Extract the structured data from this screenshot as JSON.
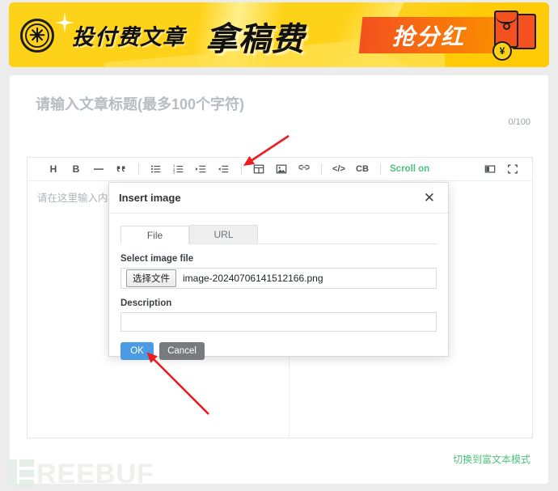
{
  "banner": {
    "coin_icon": "coin-asterisk-icon",
    "sparkle_icon": "sparkle-icon",
    "text_1": "投付费文章",
    "text_2": "拿稿费",
    "badge_text": "抢分红",
    "envelope_icon": "red-envelope-icon",
    "coin_symbol": "¥",
    "colors": {
      "background": "#ffd21a",
      "badge_from": "#f4511e",
      "badge_to": "#fb8c00"
    }
  },
  "article": {
    "title_placeholder": "请输入文章标题(最多100个字符)",
    "title_value": "",
    "counter": "0/100"
  },
  "toolbar": {
    "groups": [
      [
        {
          "name": "heading-icon",
          "glyph": "H"
        },
        {
          "name": "bold-icon",
          "glyph": "B"
        },
        {
          "name": "horizontal-rule-icon",
          "glyph": "—"
        },
        {
          "name": "quote-icon",
          "glyph": "“"
        }
      ],
      [
        {
          "name": "bullet-list-icon",
          "glyph": ""
        },
        {
          "name": "ordered-list-icon",
          "glyph": ""
        },
        {
          "name": "indent-icon",
          "glyph": ""
        },
        {
          "name": "outdent-icon",
          "glyph": ""
        }
      ],
      [
        {
          "name": "table-icon",
          "glyph": ""
        },
        {
          "name": "image-icon",
          "glyph": ""
        },
        {
          "name": "link-icon",
          "glyph": ""
        }
      ],
      [
        {
          "name": "inline-code-icon",
          "glyph": "</>"
        },
        {
          "name": "code-block-icon",
          "glyph": "CB"
        }
      ]
    ],
    "scroll_label": "Scroll on",
    "scroll_color": "#4cc27e",
    "right_icons": [
      {
        "name": "split-view-icon"
      },
      {
        "name": "fullscreen-icon"
      }
    ]
  },
  "editor": {
    "content_placeholder": "请在这里输入内容"
  },
  "modal": {
    "title": "Insert image",
    "close_icon": "close-icon",
    "tabs": [
      {
        "label": "File",
        "active": true
      },
      {
        "label": "URL",
        "active": false
      }
    ],
    "file_field": {
      "label": "Select image file",
      "button_label": "选择文件",
      "file_name": "image-20240706141512166.png"
    },
    "description_field": {
      "label": "Description",
      "value": "",
      "placeholder": ""
    },
    "ok_label": "OK",
    "cancel_label": "Cancel",
    "ok_color": "#4a9ae4",
    "cancel_color": "#777b7e"
  },
  "footer": {
    "switch_mode_label": "切换到富文本模式",
    "switch_mode_color": "#4cc27e",
    "watermark_text": "REEBUF"
  },
  "annotations": [
    {
      "name": "arrow-to-image-toolbar-button",
      "color": "#ee1c1c"
    },
    {
      "name": "arrow-to-ok-button",
      "color": "#ee1c1c"
    }
  ]
}
